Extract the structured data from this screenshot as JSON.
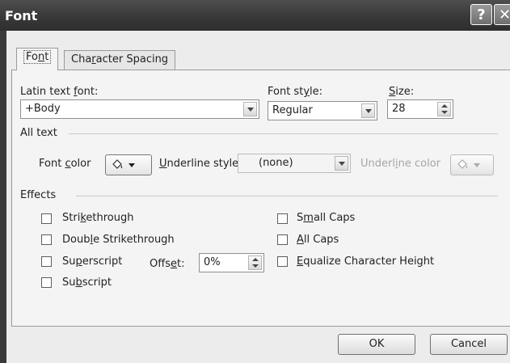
{
  "window": {
    "title": "Font",
    "help_label": "?",
    "close_label": "✕"
  },
  "tabs": [
    {
      "label_pre": "Fo",
      "label_key": "n",
      "label_post": "t",
      "active": true
    },
    {
      "label_pre": "Cha",
      "label_key": "r",
      "label_post": "acter Spacing",
      "active": false
    }
  ],
  "latin_font": {
    "label_pre": "Latin text ",
    "label_key": "f",
    "label_post": "ont:",
    "value": "+Body"
  },
  "font_style": {
    "label_pre": "Font st",
    "label_key": "y",
    "label_post": "le:",
    "value": "Regular"
  },
  "size": {
    "label_pre": "",
    "label_key": "S",
    "label_post": "ize:",
    "value": "28"
  },
  "all_text": {
    "section_label": "All text",
    "font_color_pre": "Font ",
    "font_color_key": "c",
    "font_color_post": "olor",
    "underline_style_pre": "",
    "underline_style_key": "U",
    "underline_style_post": "nderline style",
    "underline_style_value": "(none)",
    "underline_color_pre": "Underl",
    "underline_color_key": "i",
    "underline_color_post": "ne color"
  },
  "effects": {
    "section_label": "Effects",
    "left": [
      {
        "pre": "Stri",
        "key": "k",
        "post": "ethrough",
        "checked": false
      },
      {
        "pre": "Doub",
        "key": "l",
        "post": "e Strikethrough",
        "checked": false
      },
      {
        "pre": "Su",
        "key": "p",
        "post": "erscript",
        "checked": false
      },
      {
        "pre": "Su",
        "key": "b",
        "post": "script",
        "checked": false
      }
    ],
    "right": [
      {
        "pre": "S",
        "key": "m",
        "post": "all Caps",
        "checked": false
      },
      {
        "pre": "",
        "key": "A",
        "post": "ll Caps",
        "checked": false
      },
      {
        "pre": "",
        "key": "E",
        "post": "qualize Character Height",
        "checked": false
      }
    ],
    "offset_pre": "Offs",
    "offset_key": "e",
    "offset_post": "t:",
    "offset_value": "0%"
  },
  "buttons": {
    "ok": "OK",
    "cancel": "Cancel"
  },
  "colors": {
    "titlebar": "#3a3a3a",
    "dialog_bg": "#ececec",
    "panel_bg": "#f4f4f4",
    "disabled_text": "#a6a6a6"
  }
}
